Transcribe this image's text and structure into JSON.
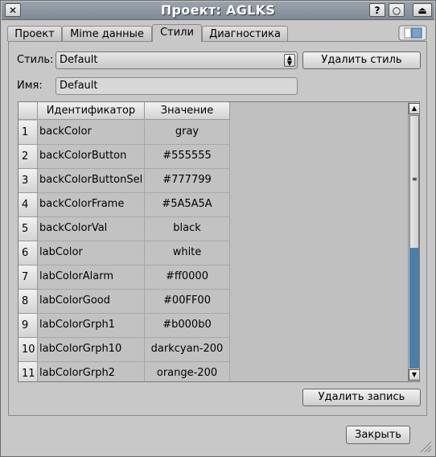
{
  "window": {
    "title": "Проект: AGLKS"
  },
  "titlebar_buttons": {
    "close": "✕",
    "help": "?",
    "maximize": "○",
    "shade": "⏏"
  },
  "tabs": [
    {
      "label": "Проект"
    },
    {
      "label": "Mime данные"
    },
    {
      "label": "Стили"
    },
    {
      "label": "Диагностика"
    }
  ],
  "active_tab": "Стили",
  "form": {
    "style_label": "Стиль:",
    "style_value": "Default",
    "delete_style_label": "Удалить стиль",
    "name_label": "Имя:",
    "name_value": "Default"
  },
  "table": {
    "columns": [
      "Идентификатор",
      "Значение"
    ],
    "rows": [
      {
        "num": "1",
        "id": "backColor",
        "value": "gray"
      },
      {
        "num": "2",
        "id": "backColorButton",
        "value": "#555555"
      },
      {
        "num": "3",
        "id": "backColorButtonSel",
        "value": "#777799"
      },
      {
        "num": "4",
        "id": "backColorFrame",
        "value": "#5A5A5A"
      },
      {
        "num": "5",
        "id": "backColorVal",
        "value": "black"
      },
      {
        "num": "6",
        "id": "labColor",
        "value": "white"
      },
      {
        "num": "7",
        "id": "labColorAlarm",
        "value": "#ff0000"
      },
      {
        "num": "8",
        "id": "labColorGood",
        "value": "#00FF00"
      },
      {
        "num": "9",
        "id": "labColorGrph1",
        "value": "#b000b0"
      },
      {
        "num": "10",
        "id": "labColorGrph10",
        "value": "darkcyan-200"
      },
      {
        "num": "11",
        "id": "labColorGrph2",
        "value": "orange-200"
      }
    ]
  },
  "buttons": {
    "delete_record": "Удалить запись",
    "close": "Закрыть"
  },
  "colors": {
    "titlebar": "#8a949f",
    "background": "#c8c8c8",
    "scroll_track": "#4a7fa8"
  }
}
